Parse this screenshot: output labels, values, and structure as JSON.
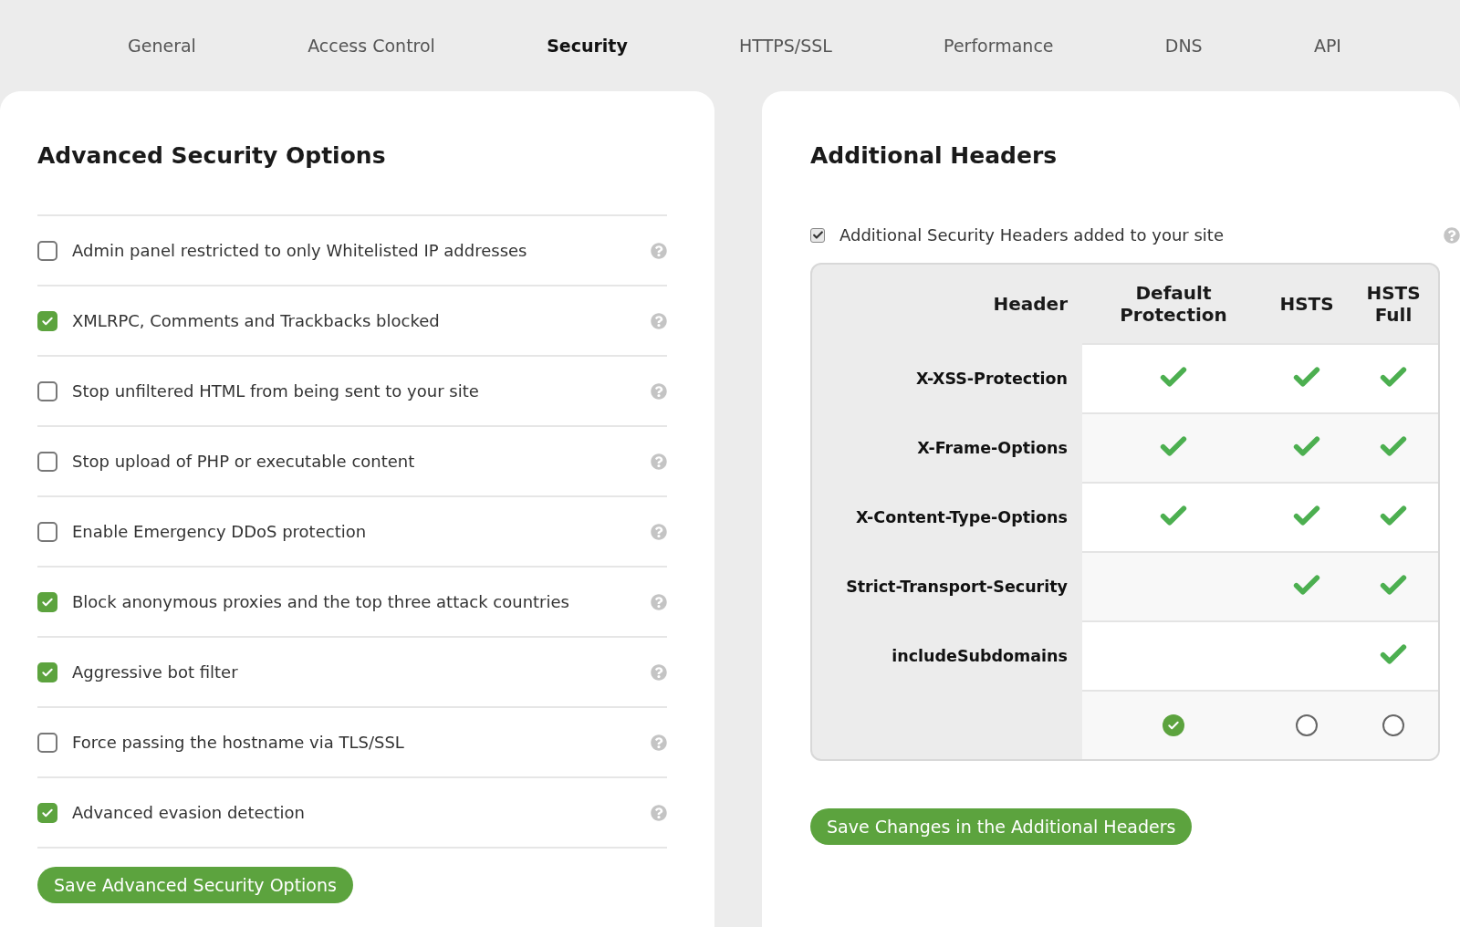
{
  "tabs": [
    {
      "label": "General",
      "selected": false
    },
    {
      "label": "Access Control",
      "selected": false
    },
    {
      "label": "Security",
      "selected": true
    },
    {
      "label": "HTTPS/SSL",
      "selected": false
    },
    {
      "label": "Performance",
      "selected": false
    },
    {
      "label": "DNS",
      "selected": false
    },
    {
      "label": "API",
      "selected": false
    }
  ],
  "security_options": {
    "title": "Advanced Security Options",
    "options": [
      {
        "label": "Admin panel restricted to only Whitelisted IP addresses",
        "checked": false
      },
      {
        "label": "XMLRPC, Comments and Trackbacks blocked",
        "checked": true
      },
      {
        "label": "Stop unfiltered HTML from being sent to your site",
        "checked": false
      },
      {
        "label": "Stop upload of PHP or executable content",
        "checked": false
      },
      {
        "label": "Enable Emergency DDoS protection",
        "checked": false
      },
      {
        "label": "Block anonymous proxies and the top three attack countries",
        "checked": true
      },
      {
        "label": "Aggressive bot filter",
        "checked": true
      },
      {
        "label": "Force passing the hostname via TLS/SSL",
        "checked": false
      },
      {
        "label": "Advanced evasion detection",
        "checked": true
      }
    ],
    "button": "Save Advanced Security Options"
  },
  "additional_headers": {
    "title": "Additional Headers",
    "enable": {
      "label": "Additional Security Headers added to your site",
      "checked": true
    },
    "table": {
      "columns": [
        "Header",
        "Default Protection",
        "HSTS",
        "HSTS Full"
      ],
      "rows": [
        {
          "header": "X-XSS-Protection",
          "checks": [
            true,
            true,
            true
          ]
        },
        {
          "header": "X-Frame-Options",
          "checks": [
            true,
            true,
            true
          ]
        },
        {
          "header": "X-Content-Type-Options",
          "checks": [
            true,
            true,
            true
          ]
        },
        {
          "header": "Strict-Transport-Security",
          "checks": [
            false,
            true,
            true
          ]
        },
        {
          "header": "includeSubdomains",
          "checks": [
            false,
            false,
            true
          ]
        }
      ],
      "choices": [
        {
          "selected": true
        },
        {
          "selected": false
        },
        {
          "selected": false
        }
      ]
    },
    "button": "Save Changes in the Additional Headers"
  }
}
